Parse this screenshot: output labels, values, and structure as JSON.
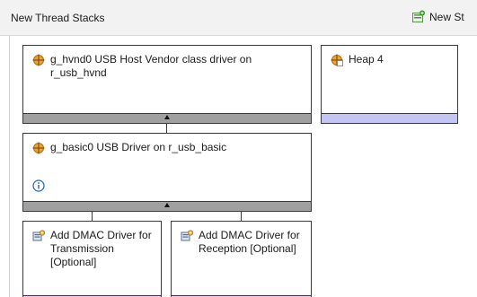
{
  "header": {
    "title": "New Thread Stacks",
    "new_stack_label": "New St"
  },
  "icons": {
    "new_stack": "new-stack-icon",
    "module": "module-icon",
    "heap": "heap-icon",
    "dmac_add": "dmac-add-icon",
    "info": "info-icon"
  },
  "colors": {
    "footer_default": "#a0a0a0",
    "footer_heap": "#c5c5f5",
    "footer_optional": "#f8c8f8",
    "info_blue": "#1f5fbf"
  },
  "stack": {
    "hvnd": {
      "label": "g_hvnd0 USB Host Vendor class driver on r_usb_hvnd"
    },
    "heap": {
      "label": "Heap 4"
    },
    "basic": {
      "label": "g_basic0 USB Driver on r_usb_basic"
    },
    "dmac_tx": {
      "label": "Add DMAC Driver for Transmission [Optional]"
    },
    "dmac_rx": {
      "label": "Add DMAC Driver for Reception [Optional]"
    }
  }
}
